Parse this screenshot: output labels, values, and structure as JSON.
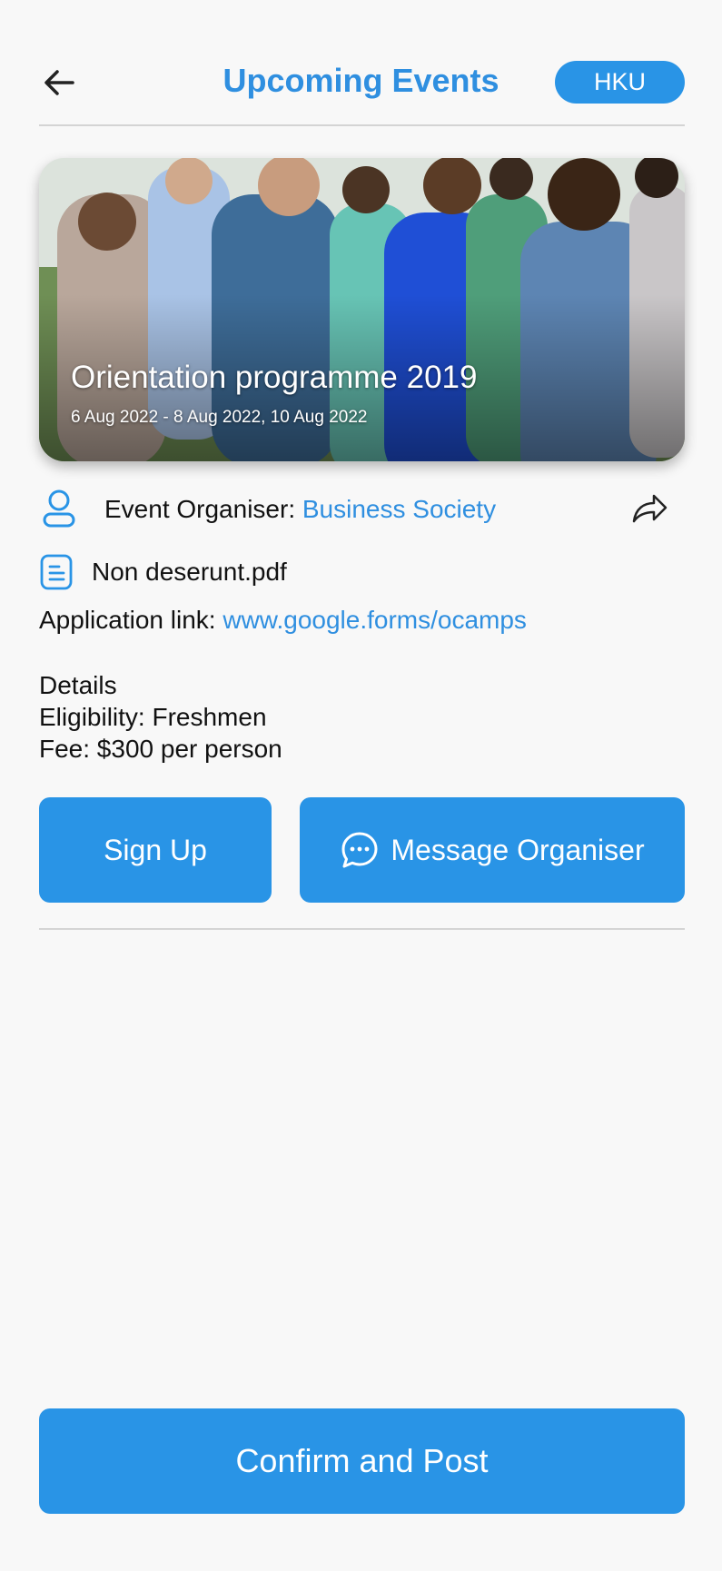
{
  "header": {
    "title": "Upcoming Events",
    "badge": "HKU",
    "back_icon": "arrow-left-icon"
  },
  "event": {
    "title": "Orientation programme 2019",
    "dates": "6 Aug 2022 - 8 Aug 2022, 10 Aug 2022"
  },
  "organiser": {
    "label": "Event Organiser: ",
    "name": "Business Society",
    "icon": "user-icon",
    "share_icon": "share-icon"
  },
  "attachment": {
    "filename": "Non deserunt.pdf",
    "icon": "document-icon"
  },
  "application": {
    "label": "Application link: ",
    "url": "www.google.forms/ocamps"
  },
  "details": {
    "heading": "Details",
    "eligibility": "Eligibility: Freshmen",
    "fee": "Fee: $300 per person"
  },
  "actions": {
    "signup_label": "Sign Up",
    "message_label": "Message Organiser",
    "confirm_label": "Confirm and Post"
  },
  "colors": {
    "accent": "#2994e6",
    "link": "#2f8fe0",
    "background": "#f8f8f8"
  }
}
